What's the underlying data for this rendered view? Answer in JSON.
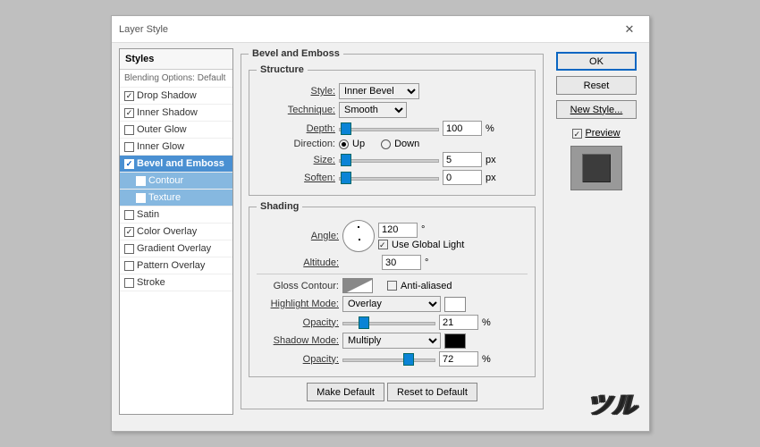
{
  "window": {
    "title": "Layer Style"
  },
  "sidebar": {
    "head": "Styles",
    "blending": "Blending Options: Default",
    "items": [
      {
        "label": "Drop Shadow",
        "ck": true
      },
      {
        "label": "Inner Shadow",
        "ck": true
      },
      {
        "label": "Outer Glow",
        "ck": false
      },
      {
        "label": "Inner Glow",
        "ck": false
      },
      {
        "label": "Bevel and Emboss",
        "ck": true,
        "sel": true
      },
      {
        "label": "Contour",
        "ck": false,
        "sub": true
      },
      {
        "label": "Texture",
        "ck": false,
        "sub": true
      },
      {
        "label": "Satin",
        "ck": false
      },
      {
        "label": "Color Overlay",
        "ck": true
      },
      {
        "label": "Gradient Overlay",
        "ck": false
      },
      {
        "label": "Pattern Overlay",
        "ck": false
      },
      {
        "label": "Stroke",
        "ck": false
      }
    ]
  },
  "panel": {
    "title": "Bevel and Emboss",
    "structure": {
      "legend": "Structure",
      "style_lbl": "Style:",
      "style_val": "Inner Bevel",
      "tech_lbl": "Technique:",
      "tech_val": "Smooth",
      "depth_lbl": "Depth:",
      "depth_val": "100",
      "depth_unit": "%",
      "dir_lbl": "Direction:",
      "up": "Up",
      "down": "Down",
      "size_lbl": "Size:",
      "size_val": "5",
      "size_unit": "px",
      "soften_lbl": "Soften:",
      "soften_val": "0",
      "soften_unit": "px"
    },
    "shading": {
      "legend": "Shading",
      "angle_lbl": "Angle:",
      "angle_val": "120",
      "deg": "°",
      "global": "Use Global Light",
      "alt_lbl": "Altitude:",
      "alt_val": "30",
      "gloss_lbl": "Gloss Contour:",
      "aa": "Anti-aliased",
      "hi_lbl": "Highlight Mode:",
      "hi_val": "Overlay",
      "op_lbl": "Opacity:",
      "hiop": "21",
      "shmode_lbl": "Shadow Mode:",
      "shmode_val": "Multiply",
      "shop": "72",
      "pct": "%"
    },
    "btn_make": "Make Default",
    "btn_reset": "Reset to Default"
  },
  "right": {
    "ok": "OK",
    "reset": "Reset",
    "new": "New Style...",
    "preview": "Preview"
  }
}
